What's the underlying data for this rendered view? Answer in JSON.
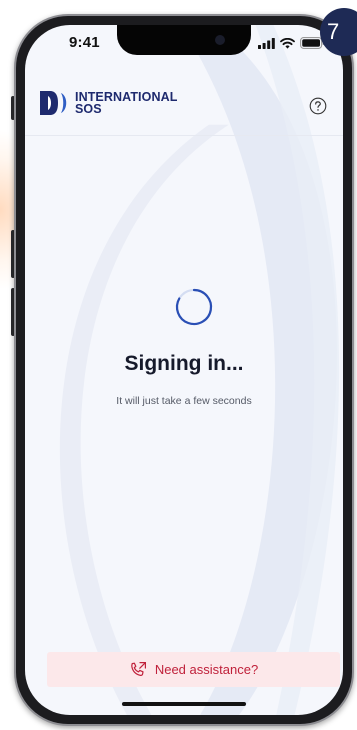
{
  "status_bar": {
    "time": "9:41",
    "signal_icon": "signal-bars-icon",
    "wifi_icon": "wifi-icon",
    "battery_icon": "battery-icon"
  },
  "step_badge": {
    "number": "7"
  },
  "header": {
    "logo_line1": "INTERNATIONAL",
    "logo_line2": "SOS",
    "logo_icon": "international-sos-logo-icon",
    "help_icon": "help-icon"
  },
  "main": {
    "spinner_icon": "loading-spinner-icon",
    "title": "Signing in...",
    "subtitle": "It will just take a few seconds"
  },
  "assistance": {
    "label": "Need assistance?",
    "icon": "phone-call-icon"
  },
  "colors": {
    "brand_navy": "#1e2a6e",
    "spinner_blue": "#2a4fb5",
    "assist_red": "#c0213b",
    "assist_bg": "#fce8ea",
    "screen_bg": "#f5f7fc",
    "badge_bg": "#1e2a55"
  }
}
